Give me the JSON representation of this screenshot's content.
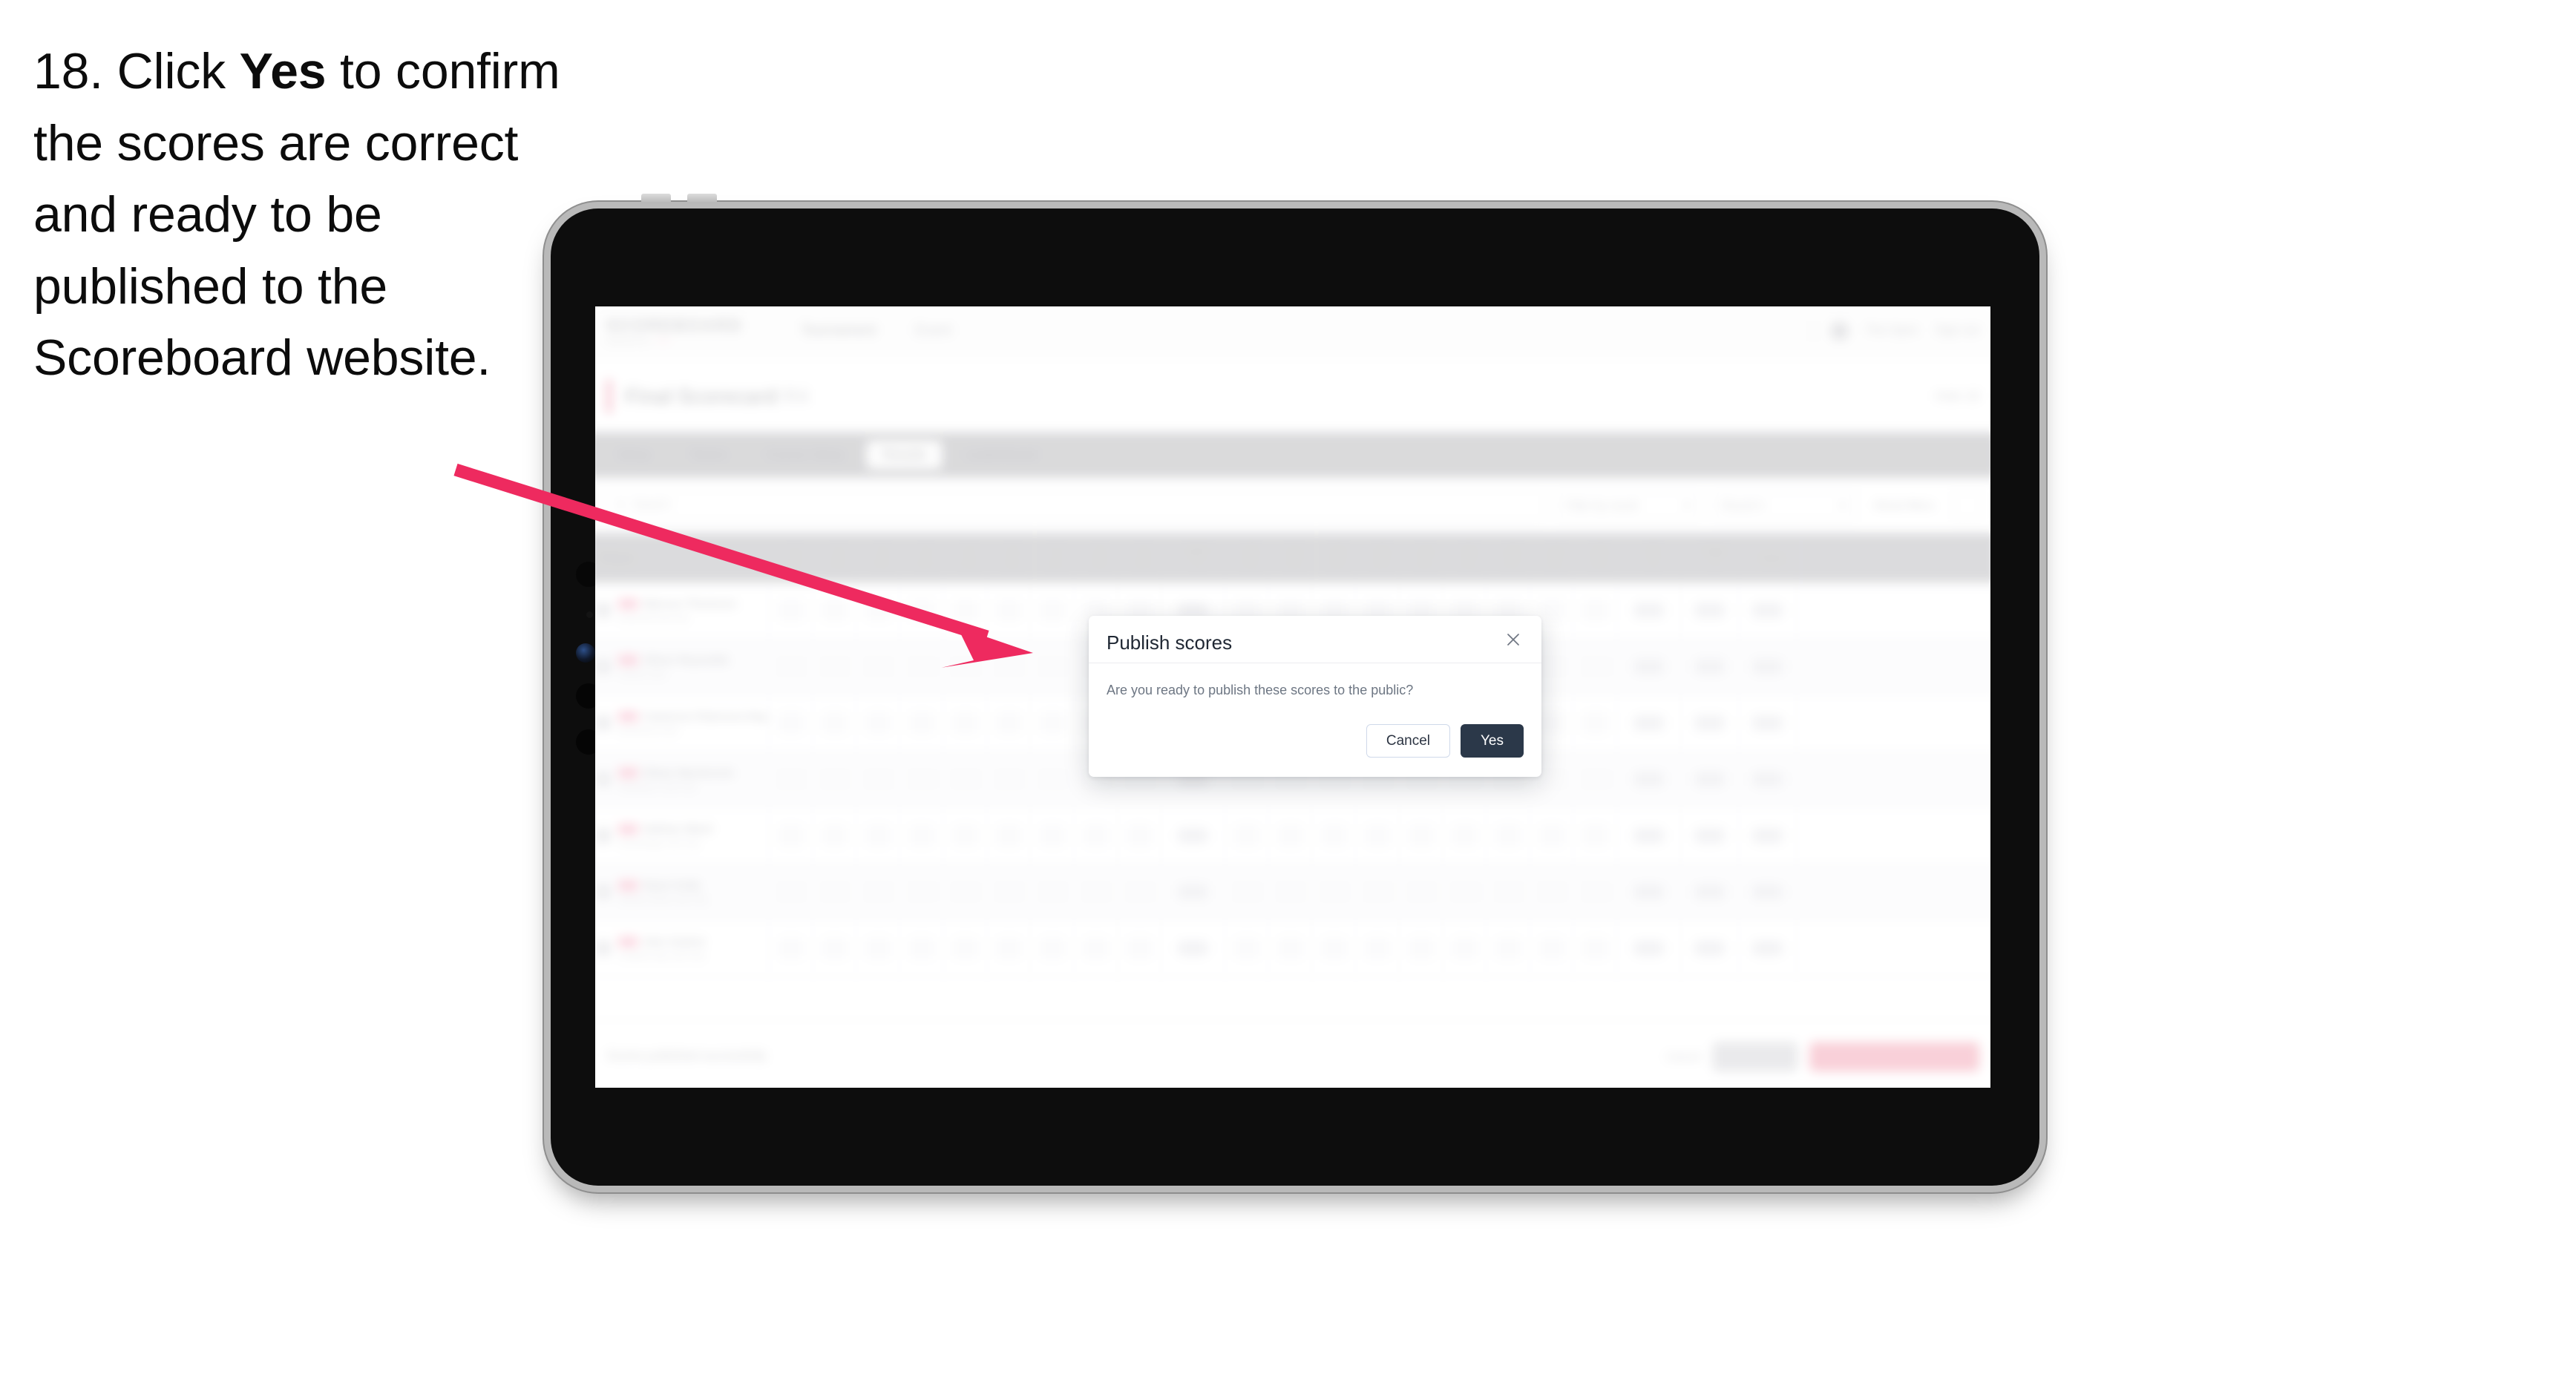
{
  "caption": {
    "step": "18.",
    "before": "Click",
    "bold": "Yes",
    "after": "to confirm the scores are correct and ready to be published to the Scoreboard website."
  },
  "colors": {
    "arrow": "#ee2a5f",
    "accent_pink": "#e8174f",
    "modal_primary": "#2b3849",
    "modal_cancel_border": "#cfd9ea",
    "device_bezel": "#0d0d0d",
    "device_frame": "#b9b9b9"
  },
  "device": {
    "name": "tablet",
    "orientation": "landscape",
    "buttons": [
      "volume-up",
      "volume-down"
    ]
  },
  "modal": {
    "title": "Publish scores",
    "message": "Are you ready to publish these scores to the public?",
    "close_icon": "close-icon",
    "cancel_label": "Cancel",
    "confirm_label": "Yes"
  },
  "app": {
    "logo": "SCOREBOARD",
    "logo_sub": "powered by",
    "logo_chip": "",
    "nav": [
      {
        "label": "Tournament",
        "active": true
      },
      {
        "label": "Event",
        "active": false
      }
    ],
    "topbar_right": [
      {
        "label": "The Open"
      },
      {
        "label": "Sign out"
      }
    ],
    "event": {
      "title": "Final Scorecard",
      "subtitle": "R4",
      "right_label": "Hole 18"
    },
    "tabs": [
      {
        "label": "Setup",
        "active": false
      },
      {
        "label": "Teams",
        "active": false
      },
      {
        "label": "Course Setup",
        "active": false
      },
      {
        "label": "Results",
        "active": true
      },
      {
        "label": "Leaderboard",
        "active": false
      }
    ],
    "filters": {
      "search_placeholder": "Search",
      "select_round": "Filter by round",
      "select_status": "Round 4",
      "link_label": "Reset filters",
      "icon": "settings-icon"
    },
    "table": {
      "columns": [
        {
          "top": "Player",
          "bottom": "",
          "kind": "player"
        },
        {
          "top": "1",
          "bottom": "Par 4",
          "kind": "hole"
        },
        {
          "top": "2",
          "bottom": "Par 4",
          "kind": "hole"
        },
        {
          "top": "3",
          "bottom": "Par 3",
          "kind": "hole"
        },
        {
          "top": "4",
          "bottom": "Par 5",
          "kind": "hole"
        },
        {
          "top": "5",
          "bottom": "Par 4",
          "kind": "hole"
        },
        {
          "top": "6",
          "bottom": "Par 4",
          "kind": "hole"
        },
        {
          "top": "7",
          "bottom": "Par 3",
          "kind": "hole"
        },
        {
          "top": "8",
          "bottom": "Par 4",
          "kind": "hole"
        },
        {
          "top": "9",
          "bottom": "Par 5",
          "kind": "hole"
        },
        {
          "top": "OUT",
          "bottom": "36",
          "kind": "wide"
        },
        {
          "top": "10",
          "bottom": "Par 4",
          "kind": "hole"
        },
        {
          "top": "11",
          "bottom": "Par 3",
          "kind": "hole"
        },
        {
          "top": "12",
          "bottom": "Par 4",
          "kind": "hole"
        },
        {
          "top": "13",
          "bottom": "Par 5",
          "kind": "hole"
        },
        {
          "top": "14",
          "bottom": "Par 4",
          "kind": "hole"
        },
        {
          "top": "15",
          "bottom": "Par 4",
          "kind": "hole"
        },
        {
          "top": "16",
          "bottom": "Par 3",
          "kind": "hole"
        },
        {
          "top": "17",
          "bottom": "Par 4",
          "kind": "hole"
        },
        {
          "top": "18",
          "bottom": "Par 5",
          "kind": "hole"
        },
        {
          "top": "IN",
          "bottom": "36",
          "kind": "wide"
        },
        {
          "top": "Total",
          "bottom": "72",
          "kind": "tot"
        },
        {
          "top": "Score",
          "bottom": "",
          "kind": "tot"
        }
      ],
      "rows": [
        {
          "name": "Marcus Thomson",
          "club": "Ravenhill Golf Club",
          "badge": true
        },
        {
          "name": "Oliver Reynolds",
          "club": "Carrick Links",
          "badge": true
        },
        {
          "name": "Cameron Paterson-Hayes",
          "club": "Brookmere Park",
          "badge": true
        },
        {
          "name": "Ethan Mackenzie",
          "club": "Westhaven Golf Club",
          "badge": true
        },
        {
          "name": "Nathan Ward",
          "club": "Stonebridge Golf Club",
          "badge": true
        },
        {
          "name": "Ryan Kelly",
          "club": "Ashford Heath Golf Club",
          "badge": true
        },
        {
          "name": "Alex Sutton",
          "club": "Lindholm Bay Golf Club",
          "badge": true
        }
      ]
    },
    "bottom": {
      "note": "Scores published successfully",
      "ghost_label": "Cancel",
      "grey_label": "Save all",
      "pink_label": "Publish scores to public"
    }
  }
}
